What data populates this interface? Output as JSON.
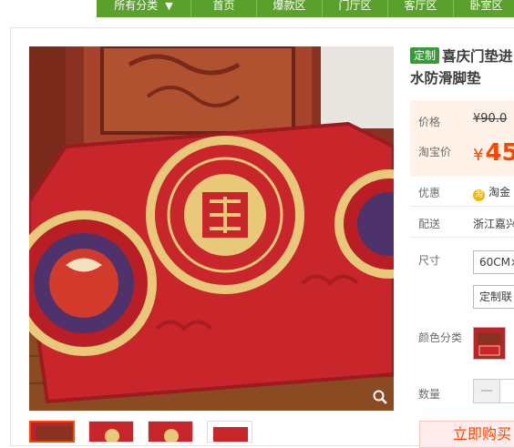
{
  "nav": {
    "category_label": "所有分类",
    "items": [
      "首页",
      "爆款区",
      "门厅区",
      "客厅区",
      "卧室区"
    ]
  },
  "product": {
    "badge": "定制",
    "title_line1": "喜庆门垫进",
    "title_line2": "水防滑脚垫"
  },
  "price": {
    "list_label": "价格",
    "list_value": "¥90.0",
    "taobao_label": "淘宝价",
    "taobao_currency": "¥",
    "taobao_value": "45"
  },
  "promo": {
    "label": "优惠",
    "coin_glyph": "淘",
    "value": "淘金"
  },
  "shipping": {
    "label": "配送",
    "value": "浙江嘉兴"
  },
  "sku": {
    "size_label": "尺寸",
    "size_option1": "60CM×",
    "size_option2": "定制联",
    "color_label": "颜色分类"
  },
  "quantity": {
    "label": "数量",
    "minus_glyph": "—"
  },
  "buy_button": "立即购买",
  "colors": {
    "nav_green": "#5aa02c",
    "badge_green": "#3a9a3a",
    "price_orange": "#ff4400",
    "mat_red": "#c8262b",
    "gold": "#e8c97a"
  },
  "icons": {
    "zoom": "magnifier-icon",
    "caret": "caret-down-icon"
  }
}
